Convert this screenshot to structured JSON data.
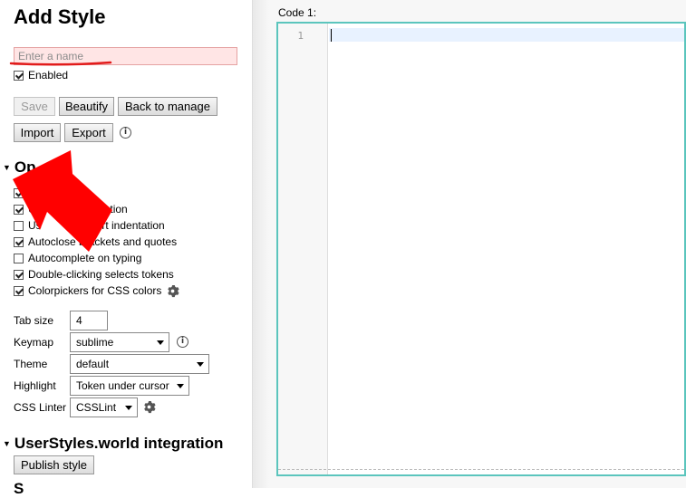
{
  "header": {
    "title": "Add Style"
  },
  "name_input": {
    "placeholder": "Enter a name",
    "value": ""
  },
  "enabled": {
    "label": "Enabled",
    "checked": true
  },
  "buttons": {
    "save": "Save",
    "beautify": "Beautify",
    "back_to_manage": "Back to manage",
    "import": "Import",
    "export": "Export"
  },
  "options": {
    "heading": "Options",
    "heading_visible": "Op",
    "checkboxes": [
      {
        "label": "",
        "checked": true
      },
      {
        "label": "U    indentation",
        "visible_left": "U",
        "visible_right": "ndentation",
        "checked": true
      },
      {
        "label": "",
        "visible_left": "Us",
        "visible_right": "h smart indentation",
        "checked": false
      },
      {
        "label": "Autoclose brackets and quotes",
        "checked": true
      },
      {
        "label": "Autocomplete on typing",
        "checked": false
      },
      {
        "label": "Double-clicking selects tokens",
        "checked": true
      },
      {
        "label": "Colorpickers for CSS colors",
        "checked": true
      }
    ],
    "tab_size_label": "Tab size",
    "tab_size_value": "4",
    "keymap_label": "Keymap",
    "keymap_value": "sublime",
    "theme_label": "Theme",
    "theme_value": "default",
    "highlight_label": "Highlight",
    "highlight_value": "Token under cursor",
    "linter_label": "CSS Linter",
    "linter_value": "CSSLint"
  },
  "usw": {
    "heading": "UserStyles.world integration",
    "publish_button": "Publish style"
  },
  "sections": {
    "heading_partial": "S"
  },
  "editor": {
    "code_label": "Code 1:",
    "line_number": "1"
  },
  "colors": {
    "editor_border": "#5bc5bd",
    "invalid_input_bg": "#ffe5e5",
    "annotation": "#ff0000"
  }
}
